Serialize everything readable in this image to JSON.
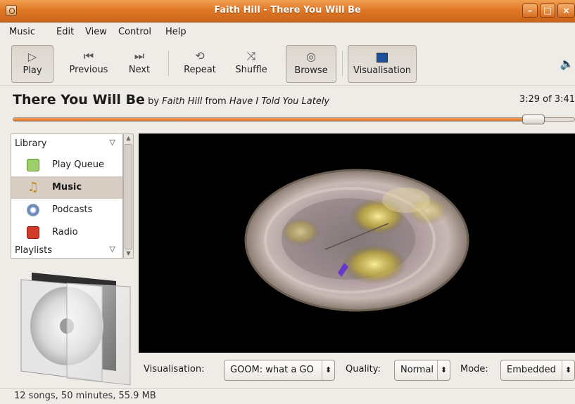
{
  "window": {
    "title": "Faith Hill - There You Will Be",
    "controls": [
      "minimize",
      "maximize",
      "close"
    ]
  },
  "menubar": [
    "Music",
    "Edit",
    "View",
    "Control",
    "Help"
  ],
  "toolbar": {
    "play": "Play",
    "previous": "Previous",
    "next": "Next",
    "repeat": "Repeat",
    "shuffle": "Shuffle",
    "browse": "Browse",
    "visualisation": "Visualisation"
  },
  "now_playing": {
    "title": "There You Will Be",
    "by_word": "by",
    "artist": "Faith Hill",
    "from_word": "from",
    "album": "Have I Told You Lately",
    "time": "3:29 of 3:41",
    "progress_fraction": 0.946
  },
  "sidebar": {
    "library_label": "Library",
    "items": [
      {
        "label": "Play Queue",
        "icon": "play-queue-icon"
      },
      {
        "label": "Music",
        "icon": "music-icon",
        "selected": true
      },
      {
        "label": "Podcasts",
        "icon": "podcast-icon"
      },
      {
        "label": "Radio",
        "icon": "radio-icon"
      }
    ],
    "playlists_label": "Playlists"
  },
  "visualisation_controls": {
    "visualisation_label": "Visualisation:",
    "visualisation_value": "GOOM: what a GO",
    "quality_label": "Quality:",
    "quality_value": "Normal",
    "mode_label": "Mode:",
    "mode_value": "Embedded"
  },
  "status": "12 songs, 50 minutes, 55.9 MB",
  "colors": {
    "titlebar": "#e07828",
    "selection": "#d7cdc2",
    "seek_fill": "#e07020",
    "window_bg": "#efebe7"
  }
}
